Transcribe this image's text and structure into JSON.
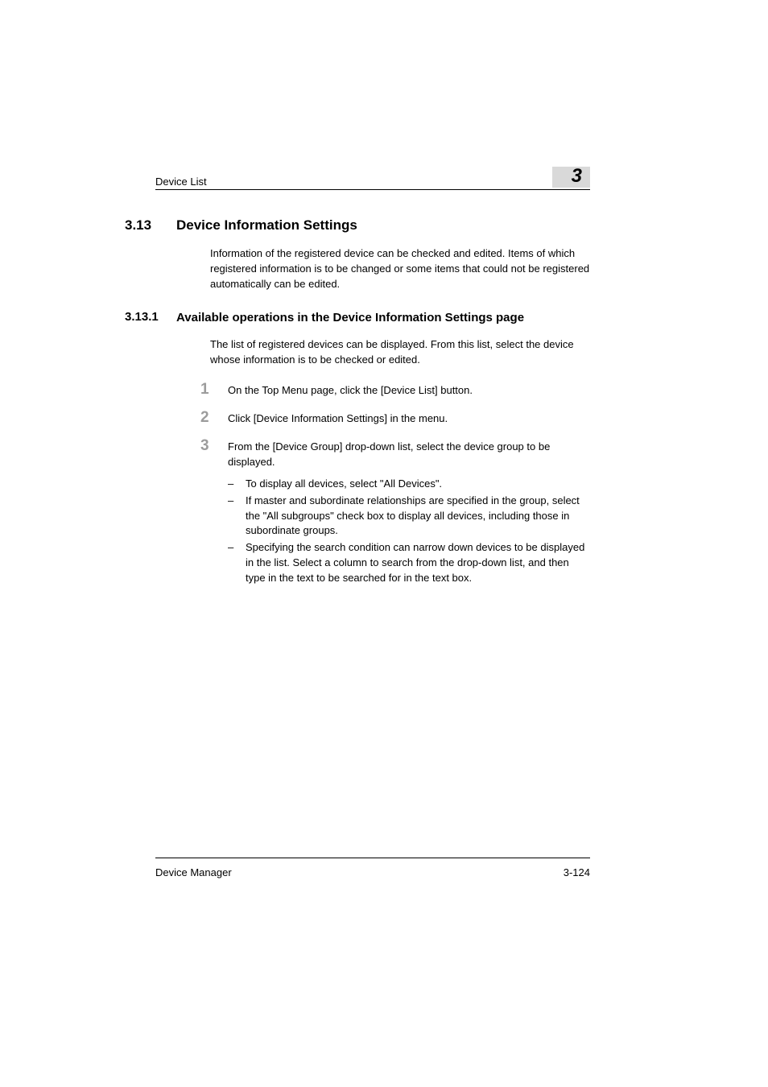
{
  "header": {
    "left": "Device List",
    "chapter": "3"
  },
  "section": {
    "number": "3.13",
    "title": "Device Information Settings",
    "body": "Information of the registered device can be checked and edited. Items of which registered information is to be changed or some items that could not be registered automatically can be edited."
  },
  "subsection": {
    "number": "3.13.1",
    "title": "Available operations in the Device Information Settings page",
    "body": "The list of registered devices can be displayed. From this list, select the device whose information is to be checked or edited."
  },
  "steps": [
    {
      "num": "1",
      "text": "On the Top Menu page, click the [Device List] button."
    },
    {
      "num": "2",
      "text": "Click [Device Information Settings] in the menu."
    },
    {
      "num": "3",
      "text": "From the [Device Group] drop-down list, select the device group to be displayed.",
      "subs": [
        "To display all devices, select \"All Devices\".",
        "If master and subordinate relationships are specified in the group, select the \"All subgroups\" check box to display all devices, including those in subordinate groups.",
        "Specifying the search condition can narrow down devices to be displayed in the list. Select a column to search from the drop-down list, and then type in the text to be searched for in the text box."
      ]
    }
  ],
  "footer": {
    "left": "Device Manager",
    "right": "3-124"
  }
}
